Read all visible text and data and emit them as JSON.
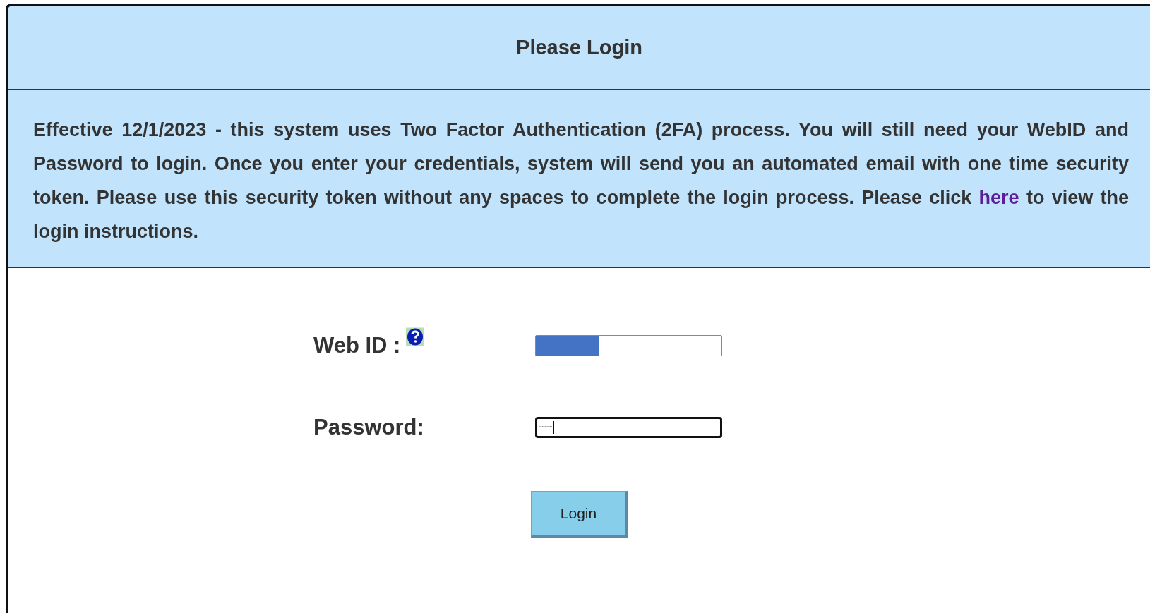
{
  "panel": {
    "title": "Please Login"
  },
  "notice": {
    "before_link": "Effective 12/1/2023 - this system uses Two Factor Authentication (2FA) process. You will still need your WebID and Password to login. Once you enter your credentials, system will send you an automated email with one time security token. Please use this security token without any spaces to complete the login process. Please click",
    "link": "here",
    "after_link": "to view the login instructions."
  },
  "fields": [
    {
      "kind": "text",
      "label": "Web ID :",
      "help": true,
      "redacted": true,
      "focused": false
    },
    {
      "kind": "password",
      "label": "Password:",
      "focused": true,
      "value": "··········"
    }
  ],
  "buttons": [
    "Login"
  ]
}
